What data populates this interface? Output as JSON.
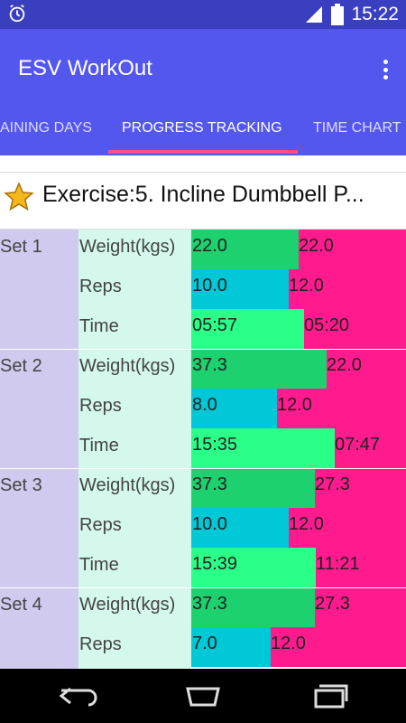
{
  "status_bar": {
    "time": "15:22",
    "icons": [
      "alarm-icon",
      "signal-icon",
      "battery-icon"
    ]
  },
  "app_bar": {
    "title": "ESV WorkOut",
    "menu_icon": "overflow-menu-icon"
  },
  "tabs": [
    {
      "label": "AINING DAYS",
      "active": false
    },
    {
      "label": "PROGRESS TRACKING",
      "active": true
    },
    {
      "label": "TIME CHART",
      "active": false
    }
  ],
  "exercise": {
    "title": "Exercise:5. Incline Dumbbell P...",
    "icon": "star-icon"
  },
  "colors": {
    "weight": "#1dd16e",
    "reps": "#00c8d6",
    "time": "#2aff88",
    "previous": "#ff1b8d",
    "accent": "#ff4c8a"
  },
  "sets": [
    {
      "label": "Set 1",
      "rows": [
        {
          "metric": "Weight(kgs)",
          "current": "22.0",
          "previous": "22.0",
          "current_fraction": 0.5
        },
        {
          "metric": "Reps",
          "current": "10.0",
          "previous": "12.0",
          "current_fraction": 0.455
        },
        {
          "metric": "Time",
          "current": "05:57",
          "previous": "05:20",
          "current_fraction": 0.527
        }
      ]
    },
    {
      "label": "Set 2",
      "rows": [
        {
          "metric": "Weight(kgs)",
          "current": "37.3",
          "previous": "22.0",
          "current_fraction": 0.629
        },
        {
          "metric": "Reps",
          "current": "8.0",
          "previous": "12.0",
          "current_fraction": 0.4
        },
        {
          "metric": "Time",
          "current": "15:35",
          "previous": "07:47",
          "current_fraction": 0.667
        }
      ]
    },
    {
      "label": "Set 3",
      "rows": [
        {
          "metric": "Weight(kgs)",
          "current": "37.3",
          "previous": "27.3",
          "current_fraction": 0.577
        },
        {
          "metric": "Reps",
          "current": "10.0",
          "previous": "12.0",
          "current_fraction": 0.455
        },
        {
          "metric": "Time",
          "current": "15:39",
          "previous": "11:21",
          "current_fraction": 0.58
        }
      ]
    },
    {
      "label": "Set 4",
      "rows": [
        {
          "metric": "Weight(kgs)",
          "current": "37.3",
          "previous": "27.3",
          "current_fraction": 0.577
        },
        {
          "metric": "Reps",
          "current": "7.0",
          "previous": "12.0",
          "current_fraction": 0.37
        }
      ]
    }
  ],
  "nav_bar": {
    "buttons": [
      "back-icon",
      "home-icon",
      "recents-icon"
    ]
  }
}
